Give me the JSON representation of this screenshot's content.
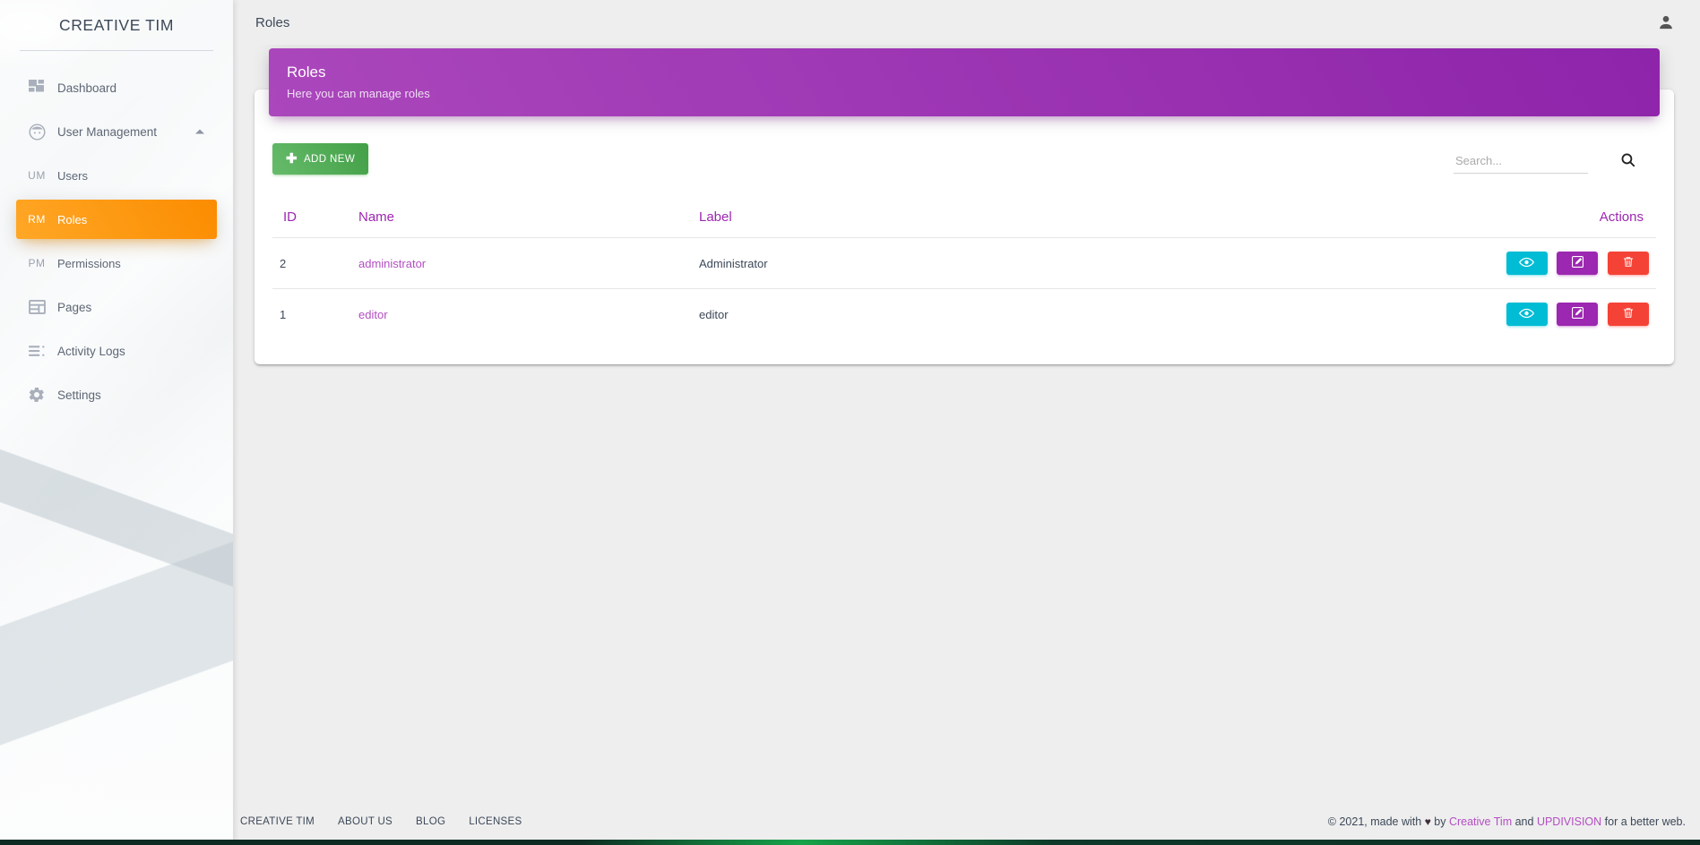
{
  "sidebar": {
    "brand": "CREATIVE TIM",
    "items": [
      {
        "label": "Dashboard",
        "icon": "dashboard-grid-icon",
        "kind": "icon",
        "active": false,
        "caret": false
      },
      {
        "label": "User Management",
        "icon": "user-circle-icon",
        "kind": "icon",
        "active": false,
        "caret": true
      },
      {
        "label": "Users",
        "icon": "UM",
        "kind": "mini",
        "active": false,
        "caret": false
      },
      {
        "label": "Roles",
        "icon": "RM",
        "kind": "mini",
        "active": true,
        "caret": false
      },
      {
        "label": "Permissions",
        "icon": "PM",
        "kind": "mini",
        "active": false,
        "caret": false
      },
      {
        "label": "Pages",
        "icon": "pages-layout-icon",
        "kind": "icon",
        "active": false,
        "caret": false
      },
      {
        "label": "Activity Logs",
        "icon": "list-lines-icon",
        "kind": "icon",
        "active": false,
        "caret": false
      },
      {
        "label": "Settings",
        "icon": "gear-icon",
        "kind": "icon",
        "active": false,
        "caret": false
      }
    ]
  },
  "topbar": {
    "title": "Roles",
    "user_icon": "person-icon"
  },
  "card": {
    "header_title": "Roles",
    "header_subtitle": "Here you can manage roles",
    "add_button": "ADD NEW",
    "add_icon": "plus-icon",
    "search_placeholder": "Search...",
    "search_value": "",
    "search_icon": "search-icon"
  },
  "table": {
    "columns": [
      "ID",
      "Name",
      "Label",
      "Actions"
    ],
    "rows": [
      {
        "id": "2",
        "name": "administrator",
        "label": "Administrator"
      },
      {
        "id": "1",
        "name": "editor",
        "label": "editor"
      }
    ],
    "row_actions": [
      {
        "name": "view-button",
        "icon": "eye-icon"
      },
      {
        "name": "edit-button",
        "icon": "pencil-square-icon"
      },
      {
        "name": "delete-button",
        "icon": "trash-icon"
      }
    ]
  },
  "footer": {
    "links": [
      "CREATIVE TIM",
      "ABOUT US",
      "BLOG",
      "LICENSES"
    ],
    "copyright_prefix": "© 2021, made with ",
    "heart": "♥",
    "copyright_by": " by ",
    "brand1": "Creative Tim",
    "copyright_and": " and ",
    "brand2": "UPDIVISION",
    "copyright_suffix": " for a better web."
  },
  "colors": {
    "accent_purple": "#9c27b0",
    "active_orange": "#fb8c00",
    "add_green": "#43a047",
    "view_cyan": "#00bcd4",
    "edit_purple": "#9c27b0",
    "delete_red": "#f44336",
    "link_pink": "#b34ec2",
    "text_dark": "#3c4858"
  }
}
